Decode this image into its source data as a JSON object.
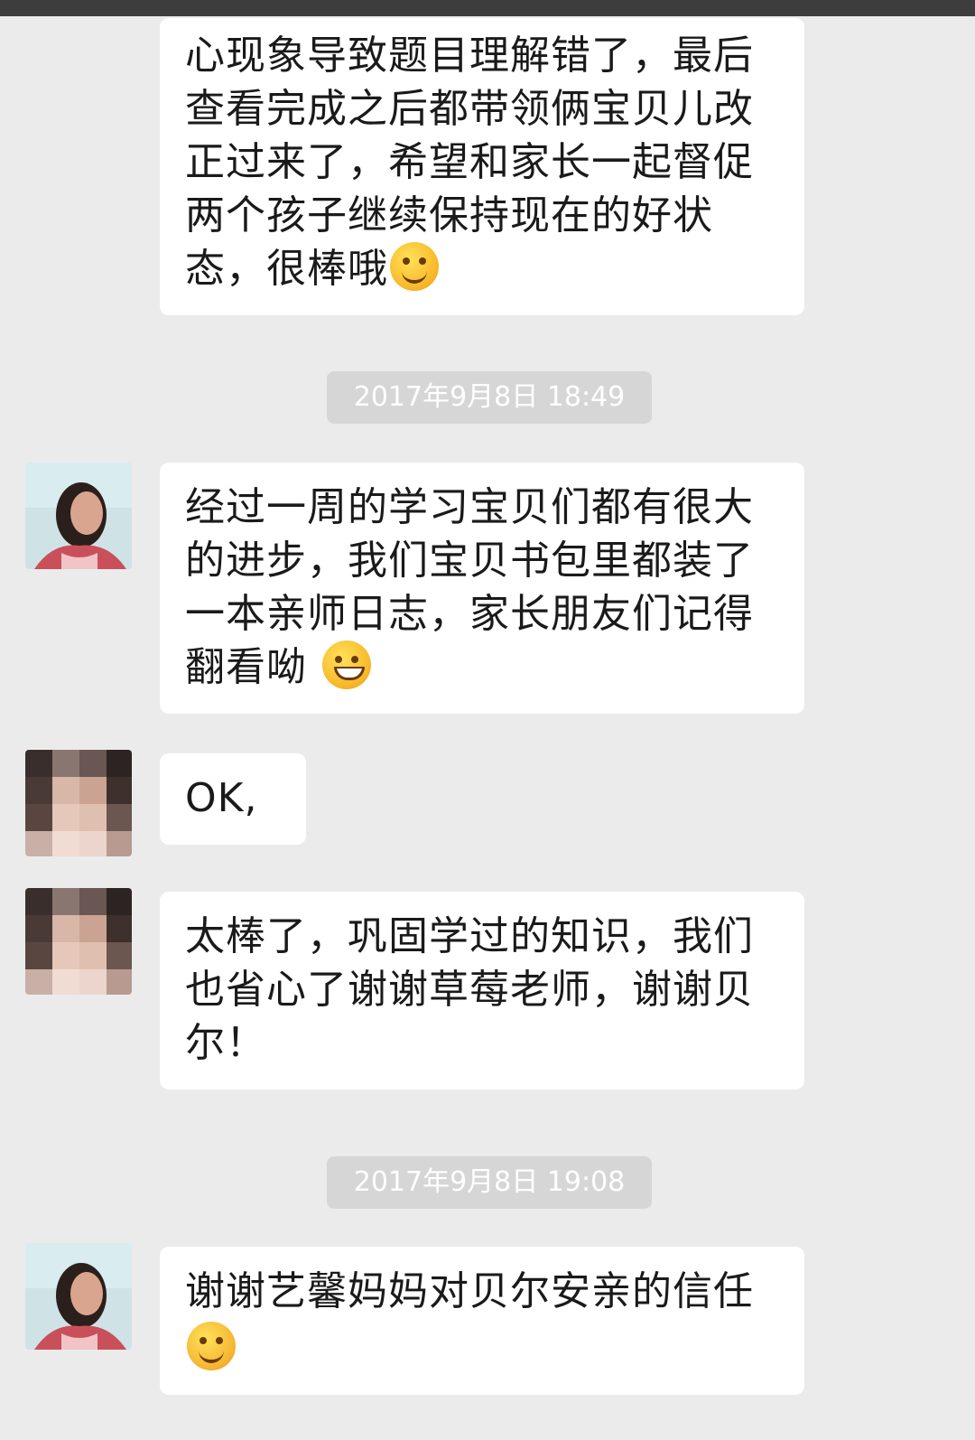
{
  "chat": {
    "messages": [
      {
        "text": "心现象导致题目理解错了，最后查看完成之后都带领俩宝贝儿改正过来了，希望和家长一起督促两个孩子继续保持现在的好状态，很棒哦"
      },
      {
        "text": "经过一周的学习宝贝们都有很大的进步，我们宝贝书包里都装了一本亲师日志，家长朋友们记得翻看呦"
      },
      {
        "text": "OK,"
      },
      {
        "text": "太棒了，巩固学过的知识，我们也省心了谢谢草莓老师，谢谢贝尔！"
      },
      {
        "text": "谢谢艺馨妈妈对贝尔安亲的信任"
      }
    ],
    "timestamps": [
      "2017年9月8日 18:49",
      "2017年9月8日 19:08"
    ]
  },
  "icons": {
    "avatar_teacher": "teacher-avatar",
    "avatar_parent": "parent-avatar-blurred",
    "emoji_smile": "smile-emoji-icon",
    "emoji_grin": "grin-emoji-icon",
    "emoji_hug": "hug-emoji-icon"
  },
  "colors": {
    "background": "#ebebeb",
    "bubble": "#ffffff",
    "timestamp_bg": "#d6d6d6"
  }
}
